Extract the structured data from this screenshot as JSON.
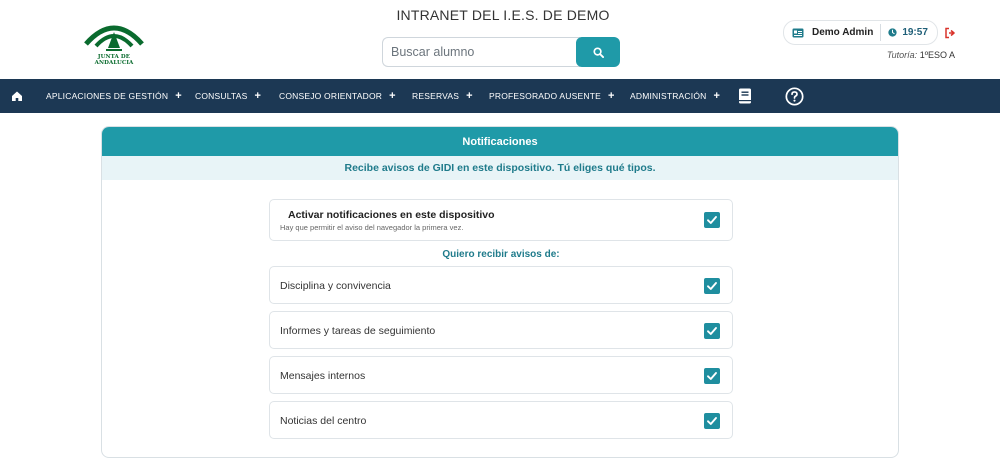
{
  "header": {
    "logo_text": "JUNTA DE ANDALUCIA",
    "title": "INTRANET DEL I.E.S. DE DEMO",
    "search_placeholder": "Buscar alumno",
    "user_name": "Demo Admin",
    "time": "19:57",
    "tutoria_label": "Tutoría:",
    "tutoria_value": "1ºESO A"
  },
  "nav": {
    "items": [
      {
        "label": "APLICACIONES DE GESTIÓN"
      },
      {
        "label": "CONSULTAS"
      },
      {
        "label": "CONSEJO ORIENTADOR"
      },
      {
        "label": "RESERVAS"
      },
      {
        "label": "PROFESORADO AUSENTE"
      },
      {
        "label": "ADMINISTRACIÓN"
      }
    ],
    "plus": "+"
  },
  "card": {
    "title": "Notificaciones",
    "subtitle": "Recibe avisos de GIDI en este dispositivo. Tú eliges qué tipos.",
    "activate_title": "Activar notificaciones en este dispositivo",
    "activate_desc": "Hay que permitir el aviso del navegador la primera vez.",
    "section_title": "Quiero recibir avisos de:",
    "options": [
      {
        "label": "Disciplina y convivencia",
        "checked": true
      },
      {
        "label": "Informes y tareas de seguimiento",
        "checked": true
      },
      {
        "label": "Mensajes internos",
        "checked": true
      },
      {
        "label": "Noticias del centro",
        "checked": true
      }
    ]
  },
  "colors": {
    "accent": "#1f9aa8",
    "nav_bg": "#1c3854",
    "checkbox": "#1f8e9f",
    "logo_green": "#0a6b2e",
    "logout_red": "#d9342b"
  },
  "icons": [
    "home-icon",
    "search-icon",
    "id-card-icon",
    "clock-icon",
    "logout-icon",
    "book-icon",
    "help-icon",
    "check-icon"
  ]
}
